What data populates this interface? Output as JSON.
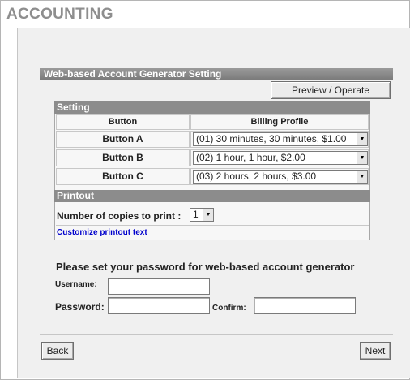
{
  "page": {
    "title": "ACCOUNTING"
  },
  "section": {
    "title": "Web-based Account Generator Setting"
  },
  "toolbar": {
    "preview_label": "Preview / Operate"
  },
  "setting": {
    "title": "Setting",
    "col_button": "Button",
    "col_billing": "Billing Profile",
    "rows": [
      {
        "button": "Button A",
        "profile": "(01) 30 minutes, 30 minutes, $1.00"
      },
      {
        "button": "Button B",
        "profile": "(02) 1 hour, 1 hour, $2.00"
      },
      {
        "button": "Button C",
        "profile": "(03) 2 hours, 2 hours, $3.00"
      }
    ]
  },
  "printout": {
    "title": "Printout",
    "copies_label": "Number of copies to print :",
    "copies_value": "1",
    "customize_link": "Customize printout text"
  },
  "password": {
    "heading": "Please set your password for web-based account generator",
    "username_label": "Username:",
    "password_label": "Password:",
    "confirm_label": "Confirm:",
    "username_value": "",
    "password_value": "",
    "confirm_value": ""
  },
  "nav": {
    "back_label": "Back",
    "next_label": "Next"
  }
}
